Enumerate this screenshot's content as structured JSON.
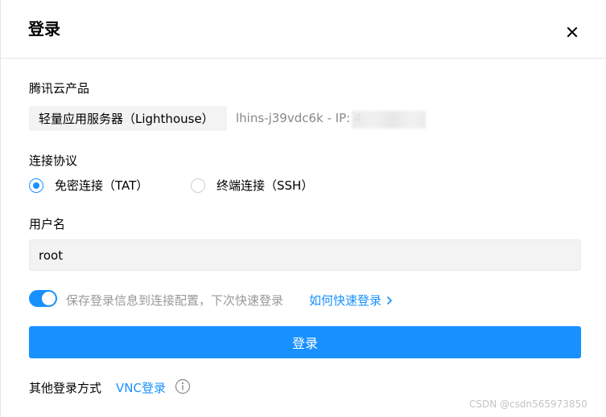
{
  "dialog": {
    "title": "登录",
    "close_icon": "close-icon"
  },
  "product": {
    "label": "腾讯云产品",
    "tag": "轻量应用服务器（Lighthouse）",
    "instance": "lhins-j39vdc6k - IP: 4"
  },
  "protocol": {
    "label": "连接协议",
    "options": [
      {
        "label": "免密连接（TAT）",
        "checked": true
      },
      {
        "label": "终端连接（SSH）",
        "checked": false
      }
    ]
  },
  "username": {
    "label": "用户名",
    "value": "root"
  },
  "save": {
    "toggle_on": true,
    "text": "保存登录信息到连接配置，下次快速登录",
    "link": "如何快速登录"
  },
  "login_button": "登录",
  "other": {
    "label": "其他登录方式",
    "vnc_link": "VNC登录",
    "info_icon": "info-icon"
  },
  "watermark": "CSDN @csdn565973850",
  "colors": {
    "primary": "#1890ff",
    "input_bg": "#f3f3f3",
    "muted_text": "#999999"
  }
}
